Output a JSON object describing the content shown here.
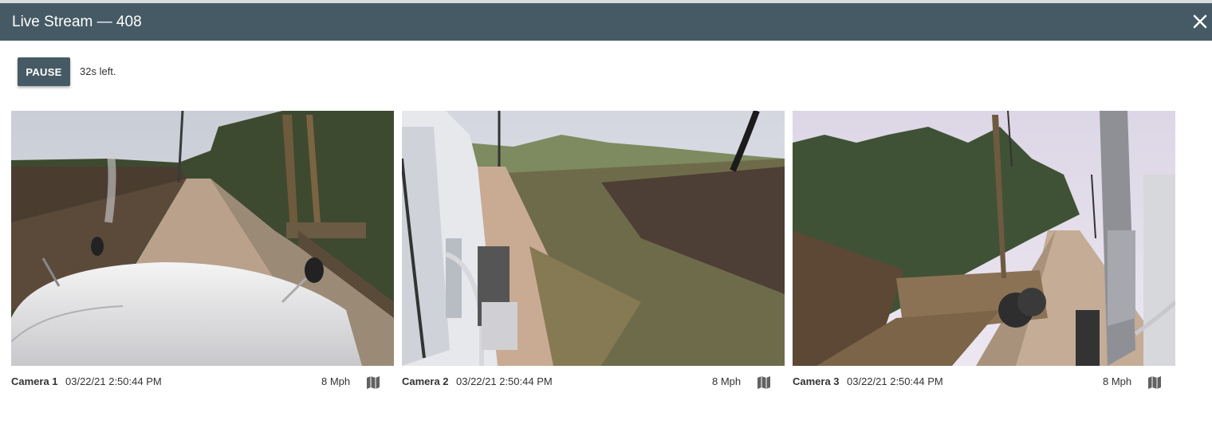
{
  "dialog": {
    "title": "Live Stream — 408"
  },
  "controls": {
    "pause_label": "PAUSE",
    "time_left": "32s left."
  },
  "cameras": [
    {
      "name": "Camera 1",
      "timestamp": "03/22/21 2:50:44 PM",
      "speed": "8 Mph"
    },
    {
      "name": "Camera 2",
      "timestamp": "03/22/21 2:50:44 PM",
      "speed": "8 Mph"
    },
    {
      "name": "Camera 3",
      "timestamp": "03/22/21 2:50:44 PM",
      "speed": "8 Mph"
    }
  ],
  "icons": {
    "close": "close-icon",
    "map": "map-icon"
  },
  "colors": {
    "header": "#455a64",
    "button": "#455a64"
  }
}
